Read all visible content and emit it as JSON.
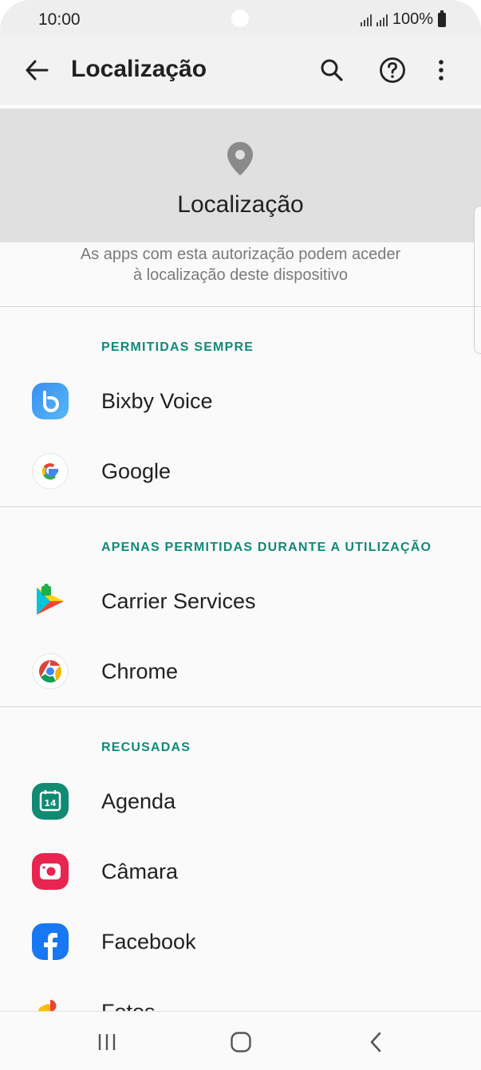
{
  "status_bar": {
    "time": "10:00",
    "battery": "100%"
  },
  "app_bar": {
    "title": "Localização",
    "icons": [
      "back-arrow-icon",
      "search-icon",
      "help-icon",
      "more-vert-icon"
    ]
  },
  "header": {
    "icon": "location-pin-icon",
    "title": "Localização",
    "description_line1": "As apps com esta autorização podem aceder",
    "description_line2": "à localização deste dispositivo"
  },
  "sections": [
    {
      "title": "PERMITIDAS SEMPRE",
      "apps": [
        {
          "name": "Bixby Voice",
          "icon": "bixby-voice-icon"
        },
        {
          "name": "Google",
          "icon": "google-icon"
        }
      ]
    },
    {
      "title": "APENAS PERMITIDAS DURANTE A UTILIZAÇÃO",
      "apps": [
        {
          "name": "Carrier Services",
          "icon": "carrier-services-icon"
        },
        {
          "name": "Chrome",
          "icon": "chrome-icon"
        }
      ]
    },
    {
      "title": "RECUSADAS",
      "apps": [
        {
          "name": "Agenda",
          "icon": "calendar-icon",
          "icon_text": "14"
        },
        {
          "name": "Câmara",
          "icon": "camera-icon"
        },
        {
          "name": "Facebook",
          "icon": "facebook-icon"
        },
        {
          "name": "Fotos",
          "icon": "photos-icon"
        }
      ]
    }
  ],
  "nav_bar": {
    "icons": [
      "recents-icon",
      "home-icon",
      "back-icon"
    ]
  },
  "colors": {
    "accent": "#0f8a7a",
    "app_bar_bg": "#f2f2f2",
    "header_bg": "#e0e0e0"
  }
}
